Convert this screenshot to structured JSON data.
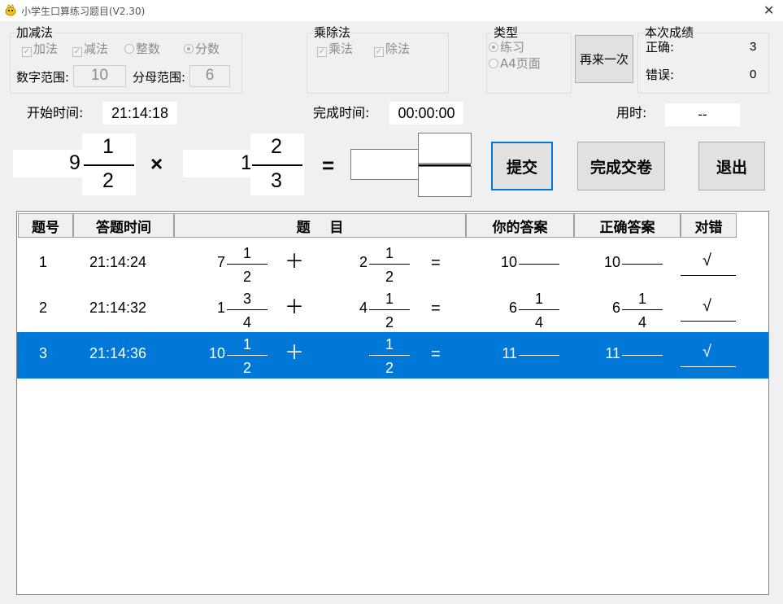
{
  "window": {
    "title": "小学生口算练习题目(V2.30)",
    "close_glyph": "✕"
  },
  "addsub": {
    "legend": "加减法",
    "add": "加法",
    "sub": "减法",
    "integer": "整数",
    "fraction": "分数",
    "range_label": "数字范围:",
    "range_value": "10",
    "denom_label": "分母范围:",
    "denom_value": "6"
  },
  "muldiv": {
    "legend": "乘除法",
    "mul": "乘法",
    "div": "除法"
  },
  "type": {
    "legend": "类型",
    "practice": "练习",
    "a4": "A4页面"
  },
  "again_button": "再来一次",
  "score": {
    "legend": "本次成绩",
    "correct_label": "正确:",
    "correct_value": "3",
    "wrong_label": "错误:",
    "wrong_value": "0"
  },
  "times": {
    "start_label": "开始时间:",
    "start_value": "21:14:18",
    "finish_label": "完成时间:",
    "finish_value": "00:00:00",
    "used_label": "用时:",
    "used_value": "--"
  },
  "question": {
    "a_whole": "9",
    "a_num": "1",
    "a_den": "2",
    "op": "×",
    "b_whole": "1",
    "b_num": "2",
    "b_den": "3",
    "eq": "="
  },
  "buttons": {
    "submit": "提交",
    "finish": "完成交卷",
    "exit": "退出"
  },
  "table": {
    "headers": {
      "no": "题号",
      "time": "答题时间",
      "question": "题    目",
      "your_answer": "你的答案",
      "correct_answer": "正确答案",
      "result": "对错"
    },
    "plus": "＋",
    "eq": "=",
    "rows": [
      {
        "no": "1",
        "time": "21:14:24",
        "aw": "7",
        "an": "1",
        "ad": "2",
        "bw": "2",
        "bn": "1",
        "bd": "2",
        "yw": "10",
        "yn": "",
        "yd": "",
        "cw": "10",
        "cn": "",
        "cd": "",
        "ok": "√"
      },
      {
        "no": "2",
        "time": "21:14:32",
        "aw": "1",
        "an": "3",
        "ad": "4",
        "bw": "4",
        "bn": "1",
        "bd": "2",
        "yw": "6",
        "yn": "1",
        "yd": "4",
        "cw": "6",
        "cn": "1",
        "cd": "4",
        "ok": "√"
      },
      {
        "no": "3",
        "time": "21:14:36",
        "aw": "10",
        "an": "1",
        "ad": "2",
        "bw": "",
        "bn": "1",
        "bd": "2",
        "yw": "11",
        "yn": "",
        "yd": "",
        "cw": "11",
        "cn": "",
        "cd": "",
        "ok": "√"
      }
    ]
  },
  "colors": {
    "selected_row": "#0078d7"
  }
}
